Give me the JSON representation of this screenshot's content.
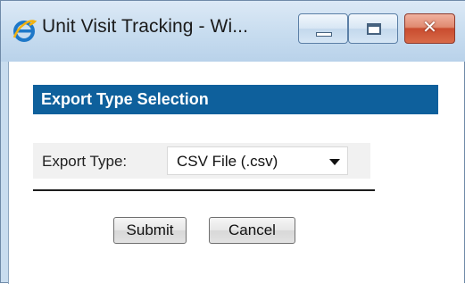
{
  "window": {
    "title": "Unit Visit Tracking - Wi...",
    "app_icon": "internet-explorer-icon",
    "controls": {
      "minimize_icon": "minimize-icon",
      "maximize_icon": "maximize-icon",
      "close_icon": "close-icon",
      "close_glyph": "✕"
    },
    "colors": {
      "close_button": "#c94c2f",
      "titlebar": "#c7dcef"
    }
  },
  "dialog": {
    "section_title": "Export Type Selection",
    "export_type": {
      "label": "Export Type:",
      "selected": "CSV File (.csv)"
    },
    "buttons": {
      "submit": "Submit",
      "cancel": "Cancel"
    },
    "colors": {
      "section_header_bg": "#0e609c",
      "form_row_bg": "#f1f1f1"
    }
  }
}
